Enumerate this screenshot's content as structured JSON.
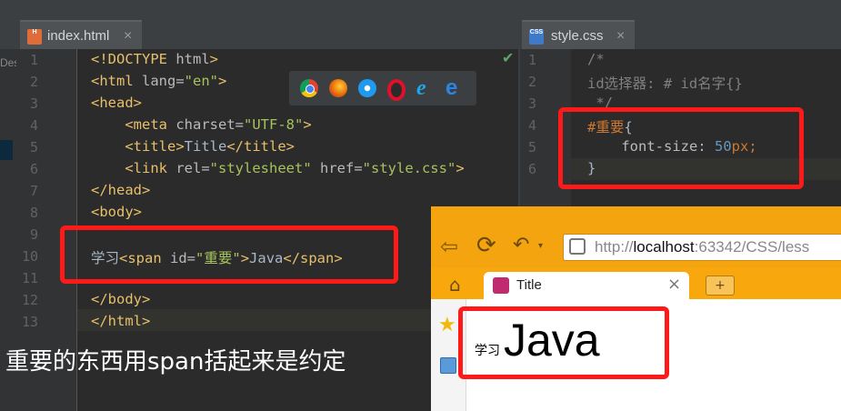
{
  "tabs": [
    {
      "label": "index.html",
      "close": "×"
    },
    {
      "label": "style.css",
      "close": "×"
    }
  ],
  "left_panel_fragment": "Des",
  "html_editor": {
    "line_numbers": [
      "1",
      "2",
      "3",
      "4",
      "5",
      "6",
      "7",
      "8",
      "9",
      "10",
      "11",
      "12",
      "13"
    ],
    "lines": [
      "<!DOCTYPE html>",
      "<html lang=\"en\">",
      "<head>",
      "    <meta charset=\"UTF-8\">",
      "    <title>Title</title>",
      "    <link rel=\"stylesheet\" href=\"style.css\">",
      "</head>",
      "<body>",
      "",
      "学习<span id=\"重要\">Java</span>",
      "",
      "</body>",
      "</html>"
    ]
  },
  "css_editor": {
    "line_numbers": [
      "1",
      "2",
      "3",
      "4",
      "5",
      "6"
    ],
    "lines": [
      "/*",
      "id选择器: # id名字{}",
      " */",
      "#重要{",
      "    font-size: 50px;",
      "}"
    ]
  },
  "browser": {
    "url_prefix": "http://",
    "url_host": "localhost",
    "url_rest": ":63342/CSS/less",
    "tab_title": "Title",
    "tab_close": "×",
    "new_tab": "+",
    "page_small": "学习",
    "page_big": "Java"
  },
  "caption": "重要的东西用span括起来是约定"
}
